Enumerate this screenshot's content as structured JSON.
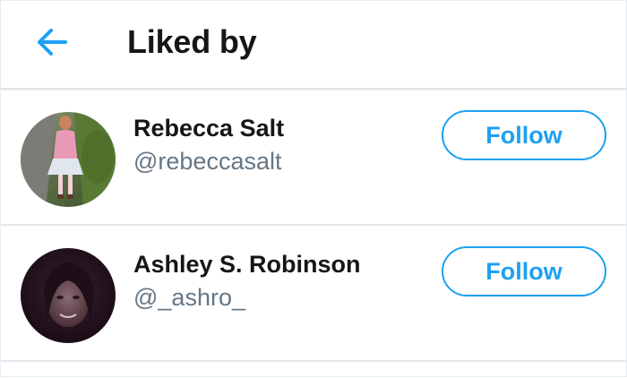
{
  "header": {
    "title": "Liked by",
    "back_icon": "arrow-left-icon",
    "accent_color": "#1da1f2"
  },
  "users": [
    {
      "name": "Rebecca Salt",
      "handle": "@rebeccasalt",
      "follow_label": "Follow",
      "avatar": "photo-avatar-girl-pink-dress"
    },
    {
      "name": "Ashley S. Robinson",
      "handle": "@_ashro_",
      "follow_label": "Follow",
      "avatar": "photo-avatar-dark-portrait"
    }
  ]
}
